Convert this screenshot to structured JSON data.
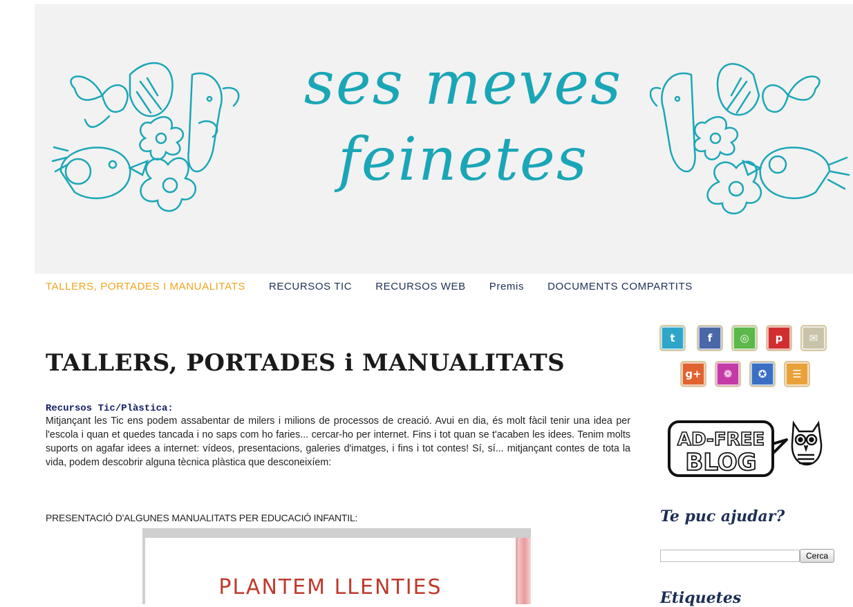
{
  "header": {
    "title_line1": "ses meves",
    "title_line2": "feinetes"
  },
  "nav": {
    "items": [
      {
        "label": "TALLERS, PORTADES I MANUALITATS",
        "active": true
      },
      {
        "label": "RECURSOS TIC"
      },
      {
        "label": "RECURSOS WEB"
      },
      {
        "label": "Premis"
      },
      {
        "label": "DOCUMENTS COMPARTITS"
      }
    ]
  },
  "post": {
    "title": "TALLERS, PORTADES i MANUALITATS",
    "section_heading": "Recursos Tic/Plàstica:",
    "paragraph": "Mitjançant les Tic ens podem assabentar de milers i milions de processos de creació. Avui en dia, és molt fàcil tenir una idea per l'escola i quan et quedes tancada i no saps com ho faries... cercar-ho per internet. Fins i tot quan se t'acaben les idees. Tenim molts suports on agafar idees a internet: vídeos, presentacions, galeries d'imatges, i fins i tot contes! Sí, sí... mitjançant contes de tota la vida, podem descobrir alguna tècnica plàstica que desconeixíem:",
    "subheading": "PRESENTACIÓ D'ALGUNES MANUALITATS PER EDUCACIÓ INFANTIL:",
    "slide_title": "PLANTEM LLENTIES"
  },
  "sidebar": {
    "social_icons": [
      {
        "name": "twitter-icon",
        "glyph": "t",
        "color": "#2fa6c9"
      },
      {
        "name": "facebook-icon",
        "glyph": "f",
        "color": "#4a67a8"
      },
      {
        "name": "target-icon",
        "glyph": "◎",
        "color": "#5cb84a"
      },
      {
        "name": "pinterest-icon",
        "glyph": "p",
        "color": "#d12f2f"
      },
      {
        "name": "mail-icon",
        "glyph": "✉",
        "color": "#c9c3a9"
      },
      {
        "name": "google-plus-icon",
        "glyph": "g+",
        "color": "#e0622f"
      },
      {
        "name": "flickr-icon",
        "glyph": "❁",
        "color": "#c43aa6"
      },
      {
        "name": "spiral-icon",
        "glyph": "✪",
        "color": "#3a6fc4"
      },
      {
        "name": "rss-icon",
        "glyph": "☰",
        "color": "#e9a13a"
      }
    ],
    "adfree_line1": "AD-FREE",
    "adfree_line2": "BLOG",
    "search_title": "Te puc ajudar?",
    "search_button": "Cerca",
    "search_value": "",
    "labels_title": "Etiquetes"
  }
}
